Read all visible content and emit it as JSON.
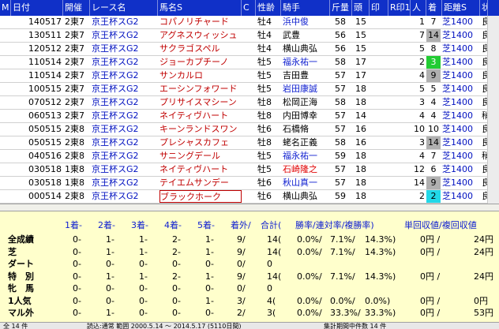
{
  "columns": [
    "M",
    "日付",
    "開催",
    "レース名",
    "馬名S",
    "C",
    "性齢",
    "騎手",
    "斤量",
    "頭",
    "印",
    "R印1",
    "人",
    "着",
    "距離S",
    "状"
  ],
  "rows": [
    {
      "date": "140517",
      "kai": "2東7",
      "race": "京王杯スG2",
      "horse": "コパノリチャード",
      "sex": "牡4",
      "jockey": "浜中俊",
      "weight": "58",
      "heads": "15",
      "pop": "1",
      "rank": "7",
      "dist": "芝1400",
      "cond": "良",
      "rank_style": "",
      "jockey_style": "blue",
      "selected": false
    },
    {
      "date": "130511",
      "kai": "2東7",
      "race": "京王杯スG2",
      "horse": "アグネスウィッシュ",
      "sex": "牡4",
      "jockey": "武豊",
      "weight": "56",
      "heads": "15",
      "pop": "7",
      "rank": "14",
      "dist": "芝1400",
      "cond": "良",
      "rank_style": "gray",
      "jockey_style": "",
      "selected": false
    },
    {
      "date": "120512",
      "kai": "2東7",
      "race": "京王杯スG2",
      "horse": "サクラゴスペル",
      "sex": "牡4",
      "jockey": "横山典弘",
      "weight": "56",
      "heads": "15",
      "pop": "5",
      "rank": "8",
      "dist": "芝1400",
      "cond": "良",
      "rank_style": "",
      "jockey_style": "",
      "selected": false
    },
    {
      "date": "110514",
      "kai": "2東7",
      "race": "京王杯スG2",
      "horse": "ジョーカプチーノ",
      "sex": "牡5",
      "jockey": "福永祐一",
      "weight": "58",
      "heads": "17",
      "pop": "2",
      "rank": "3",
      "dist": "芝1400",
      "cond": "良",
      "rank_style": "green",
      "jockey_style": "blue",
      "selected": false
    },
    {
      "date": "110514",
      "kai": "2東7",
      "race": "京王杯スG2",
      "horse": "サンカルロ",
      "sex": "牡5",
      "jockey": "吉田豊",
      "weight": "57",
      "heads": "17",
      "pop": "4",
      "rank": "9",
      "dist": "芝1400",
      "cond": "良",
      "rank_style": "gray",
      "jockey_style": "",
      "selected": false
    },
    {
      "date": "100515",
      "kai": "2東7",
      "race": "京王杯スG2",
      "horse": "エーシンフォワード",
      "sex": "牡5",
      "jockey": "岩田康誠",
      "weight": "57",
      "heads": "18",
      "pop": "5",
      "rank": "5",
      "dist": "芝1400",
      "cond": "良",
      "rank_style": "",
      "jockey_style": "blue",
      "selected": false
    },
    {
      "date": "070512",
      "kai": "2東7",
      "race": "京王杯スG2",
      "horse": "プリサイスマシーン",
      "sex": "牡8",
      "jockey": "松岡正海",
      "weight": "58",
      "heads": "18",
      "pop": "3",
      "rank": "4",
      "dist": "芝1400",
      "cond": "良",
      "rank_style": "",
      "jockey_style": "",
      "selected": false
    },
    {
      "date": "060513",
      "kai": "2東7",
      "race": "京王杯スG2",
      "horse": "ネイティヴハート",
      "sex": "牡8",
      "jockey": "内田博幸",
      "weight": "57",
      "heads": "14",
      "pop": "4",
      "rank": "4",
      "dist": "芝1400",
      "cond": "稍",
      "rank_style": "",
      "jockey_style": "",
      "selected": false
    },
    {
      "date": "050515",
      "kai": "2東8",
      "race": "京王杯スG2",
      "horse": "キーンランドスワン",
      "sex": "牡6",
      "jockey": "石橋脩",
      "weight": "57",
      "heads": "16",
      "pop": "10",
      "rank": "10",
      "dist": "芝1400",
      "cond": "良",
      "rank_style": "",
      "jockey_style": "",
      "selected": false
    },
    {
      "date": "050515",
      "kai": "2東8",
      "race": "京王杯スG2",
      "horse": "プレシャスカフェ",
      "sex": "牡8",
      "jockey": "蛯名正義",
      "weight": "58",
      "heads": "16",
      "pop": "3",
      "rank": "14",
      "dist": "芝1400",
      "cond": "良",
      "rank_style": "gray",
      "jockey_style": "",
      "selected": false
    },
    {
      "date": "040516",
      "kai": "2東8",
      "race": "京王杯スG2",
      "horse": "サニングデール",
      "sex": "牡5",
      "jockey": "福永祐一",
      "weight": "59",
      "heads": "18",
      "pop": "4",
      "rank": "7",
      "dist": "芝1400",
      "cond": "稍",
      "rank_style": "",
      "jockey_style": "blue",
      "selected": false
    },
    {
      "date": "030518",
      "kai": "1東8",
      "race": "京王杯スG2",
      "horse": "ネイティヴハート",
      "sex": "牡5",
      "jockey": "石崎隆之",
      "weight": "57",
      "heads": "18",
      "pop": "12",
      "rank": "6",
      "dist": "芝1400",
      "cond": "良",
      "rank_style": "",
      "jockey_style": "red",
      "selected": false
    },
    {
      "date": "030518",
      "kai": "1東8",
      "race": "京王杯スG2",
      "horse": "テイエムサンデー",
      "sex": "牡6",
      "jockey": "秋山真一",
      "weight": "57",
      "heads": "18",
      "pop": "14",
      "rank": "9",
      "dist": "芝1400",
      "cond": "良",
      "rank_style": "gray",
      "jockey_style": "blue",
      "selected": false
    },
    {
      "date": "000514",
      "kai": "2東8",
      "race": "京王杯スG2",
      "horse": "ブラックホーク",
      "sex": "牡6",
      "jockey": "横山典弘",
      "weight": "59",
      "heads": "18",
      "pop": "2",
      "rank": "2",
      "dist": "芝1400",
      "cond": "良",
      "rank_style": "cyan",
      "jockey_style": "",
      "selected": true
    }
  ],
  "summary": {
    "headers": [
      "1着-",
      "2着-",
      "3着-",
      "4着-",
      "5着-",
      "着外/",
      "合計(",
      "勝率/連対率/複勝率)",
      "単回収値/複回収値"
    ],
    "rows": [
      {
        "label": "全成績",
        "v": [
          "0-",
          "1-",
          "1-",
          "2-",
          "1-",
          "9/",
          "14(",
          "0.0%/",
          "7.1%/",
          "14.3%)",
          "0円 /",
          "24円"
        ]
      },
      {
        "label": "芝",
        "v": [
          "0-",
          "1-",
          "1-",
          "2-",
          "1-",
          "9/",
          "14(",
          "0.0%/",
          "7.1%/",
          "14.3%)",
          "0円 /",
          "24円"
        ]
      },
      {
        "label": "ダート",
        "v": [
          "0-",
          "0-",
          "0-",
          "0-",
          "0-",
          "0/",
          "0",
          "",
          "",
          "",
          "",
          ""
        ]
      },
      {
        "label": "特　別",
        "v": [
          "0-",
          "1-",
          "1-",
          "2-",
          "1-",
          "9/",
          "14(",
          "0.0%/",
          "7.1%/",
          "14.3%)",
          "0円 /",
          "24円"
        ]
      },
      {
        "label": "牝　馬",
        "v": [
          "0-",
          "0-",
          "0-",
          "0-",
          "0-",
          "0/",
          "0",
          "",
          "",
          "",
          "",
          ""
        ]
      },
      {
        "label": "1人気",
        "v": [
          "0-",
          "0-",
          "0-",
          "0-",
          "1-",
          "3/",
          "4(",
          "0.0%/",
          "0.0%/",
          "0.0%)",
          "0円 /",
          "0円"
        ]
      },
      {
        "label": "マル外",
        "v": [
          "0-",
          "1-",
          "0-",
          "0-",
          "0-",
          "2/",
          "3(",
          "0.0%/",
          "33.3%/",
          "33.3%)",
          "0円 /",
          "53円"
        ]
      }
    ]
  },
  "footer": {
    "left": "全 14 件",
    "mid": "読込:通常 範囲 2000.5.14 ～ 2014.5.17 (5110日間)",
    "right": "集計期間中件数 14 件"
  },
  "colors": {
    "header_bg": "#1030c8",
    "summary_bg": "#ffffcc",
    "race_text": "#0010c0",
    "horse_text": "#c00000"
  }
}
